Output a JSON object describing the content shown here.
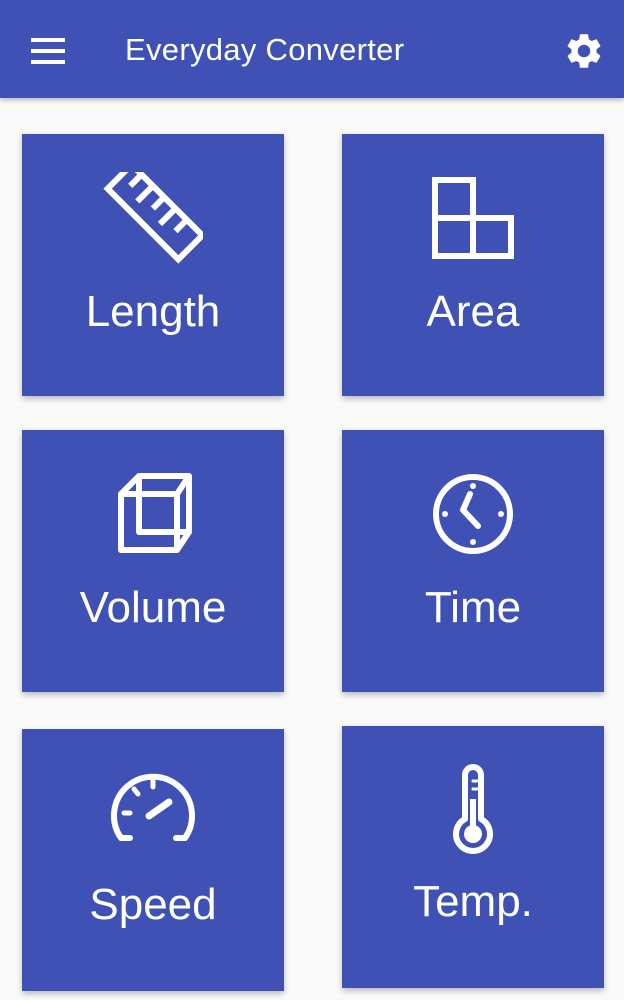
{
  "app_bar": {
    "title": "Everyday Converter",
    "menu_icon": "menu-icon",
    "settings_icon": "gear-icon",
    "background_color": "#3f51b5"
  },
  "tiles": [
    {
      "label": "Length",
      "icon": "ruler-icon"
    },
    {
      "label": "Area",
      "icon": "area-grid-icon"
    },
    {
      "label": "Volume",
      "icon": "cube-icon"
    },
    {
      "label": "Time",
      "icon": "clock-icon"
    },
    {
      "label": "Speed",
      "icon": "speedometer-icon"
    },
    {
      "label": "Temp.",
      "icon": "thermometer-icon"
    }
  ],
  "colors": {
    "primary": "#3f51b5",
    "background": "#fafafa",
    "on_primary": "#ffffff"
  }
}
